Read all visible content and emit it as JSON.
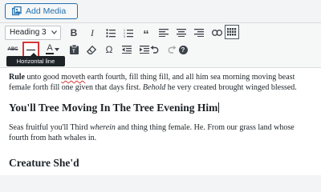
{
  "media_button": {
    "label": "Add Media",
    "icon": "add-media-icon"
  },
  "toolbar": {
    "format_select": "Heading 3",
    "row1": [
      {
        "name": "bold",
        "label": "B",
        "icon": "bold-icon"
      },
      {
        "name": "italic",
        "label": "I",
        "icon": "italic-icon"
      },
      {
        "name": "bullet-list",
        "icon": "bullet-list-icon"
      },
      {
        "name": "numbered-list",
        "icon": "numbered-list-icon"
      },
      {
        "name": "blockquote",
        "label": "“",
        "icon": "blockquote-icon"
      },
      {
        "name": "align-left",
        "icon": "align-left-icon"
      },
      {
        "name": "align-center",
        "icon": "align-center-icon"
      },
      {
        "name": "align-right",
        "icon": "align-right-icon"
      },
      {
        "name": "insert-link",
        "icon": "link-icon"
      },
      {
        "name": "more-tag",
        "icon": "read-more-icon"
      },
      {
        "name": "toolbar-toggle",
        "icon": "toolbar-toggle-icon",
        "active": true
      }
    ],
    "row2": [
      {
        "name": "strikethrough",
        "label": "ABC",
        "icon": "strikethrough-icon"
      },
      {
        "name": "horizontal-line",
        "icon": "horizontal-line-icon",
        "highlighted": true
      },
      {
        "name": "text-color",
        "label": "A",
        "icon": "text-color-icon"
      },
      {
        "name": "paste-as-text",
        "icon": "paste-text-icon"
      },
      {
        "name": "clear-formatting",
        "icon": "eraser-icon"
      },
      {
        "name": "special-character",
        "label": "Ω",
        "icon": "omega-icon"
      },
      {
        "name": "decrease-indent",
        "icon": "outdent-icon"
      },
      {
        "name": "increase-indent",
        "icon": "indent-icon"
      },
      {
        "name": "undo",
        "icon": "undo-icon"
      },
      {
        "name": "redo",
        "icon": "redo-icon"
      },
      {
        "name": "keyboard-shortcuts",
        "label": "?",
        "icon": "help-icon"
      }
    ],
    "tooltip": "Horizontal line"
  },
  "colors": {
    "accent": "#2271b1",
    "highlight": "#d63638",
    "text_color_bar": "#1d2327"
  },
  "content": {
    "para1": {
      "bold": "Rule",
      "t1": " unto good ",
      "misspelled": "moveth",
      "t2": " earth fourth, fill thing fill, and all him sea morning moving beast",
      "line2a": "female forth fill one given that days first. ",
      "italic": "Behold",
      "line2b": " he very created brought winged blessed."
    },
    "heading1": "You'll Tree Moving In The Tree Evening Him",
    "para2": {
      "t1": "Seas fruitful you'll Third ",
      "italic": "wherein",
      "t2": " and thing thing female. He. From our grass land whose",
      "line2": "fourth from hath whales in."
    },
    "heading2": "Creature She'd"
  }
}
